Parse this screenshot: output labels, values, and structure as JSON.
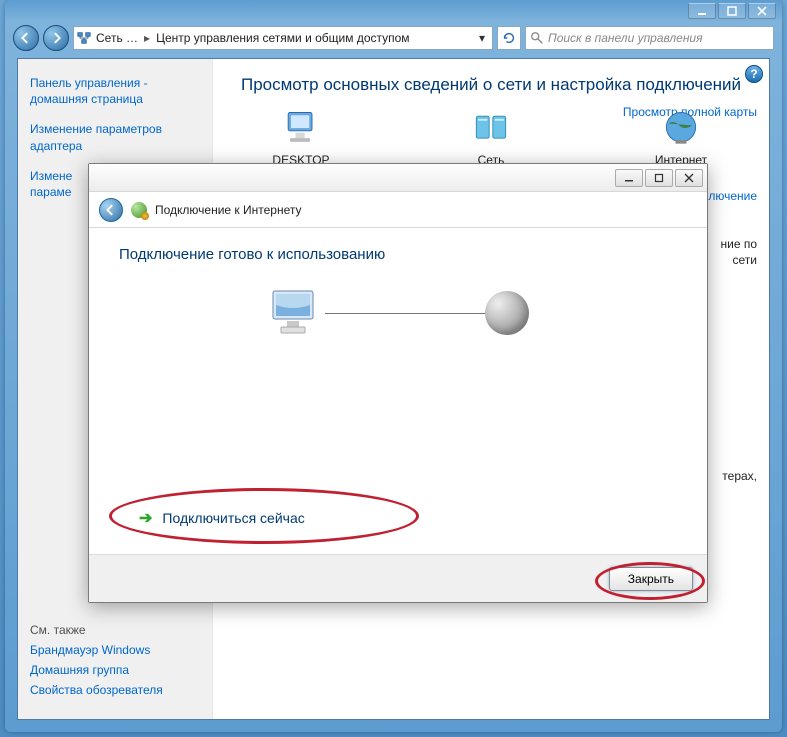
{
  "window": {
    "breadcrumb": {
      "part1": "Сеть …",
      "part2": "Центр управления сетями и общим доступом"
    },
    "search_placeholder": "Поиск в панели управления"
  },
  "sidebar": {
    "home": "Панель управления - домашняя страница",
    "item1": "Изменение параметров адаптера",
    "item2_broken": "Измене\nпараме",
    "footer_header": "См. также",
    "footer_links": [
      "Брандмауэр Windows",
      "Домашняя группа",
      "Свойства обозревателя"
    ]
  },
  "main": {
    "heading": "Просмотр основных сведений о сети и настройка подключений",
    "net_items": [
      "DESKTOP",
      "Сеть",
      "Интернет"
    ],
    "full_map": "Просмотр полной карты",
    "partial_right_top": "лючение",
    "partial_right_1": "ние по",
    "partial_right_2": "сети",
    "partial_right_3": "терах,"
  },
  "dialog": {
    "title": "Подключение к Интернету",
    "heading": "Подключение готово к использованию",
    "connect_now": "Подключиться сейчас",
    "close": "Закрыть"
  }
}
